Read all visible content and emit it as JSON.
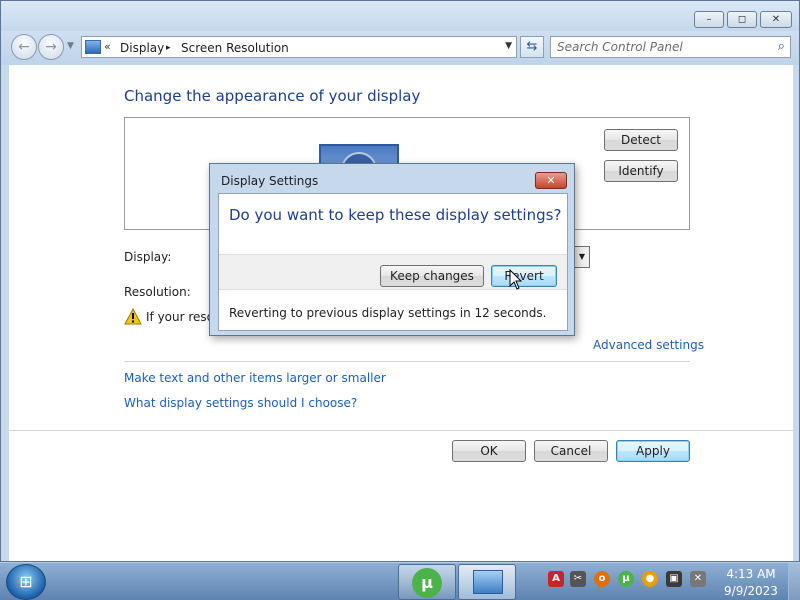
{
  "window": {
    "caption_buttons": {
      "minimize": "–",
      "maximize": "◻",
      "close": "✕"
    }
  },
  "navbar": {
    "back_icon": "arrow-left-icon",
    "forward_icon": "arrow-right-icon",
    "breadcrumb": [
      "Display",
      "Screen Resolution"
    ],
    "chevron": "«",
    "separator": "▸",
    "search_placeholder": "Search Control Panel"
  },
  "main": {
    "title": "Change the appearance of your display",
    "detect_label": "Detect",
    "identify_label": "Identify",
    "display_label": "Display:",
    "resolution_label": "Resolution:",
    "warning_text": "If your resolu",
    "advanced_link": "Advanced settings",
    "link_larger": "Make text and other items larger or smaller",
    "link_which": "What display settings should I choose?",
    "ok_label": "OK",
    "cancel_label": "Cancel",
    "apply_label": "Apply"
  },
  "dialog": {
    "title": "Display Settings",
    "question": "Do you want to keep these display settings?",
    "keep_label": "Keep changes",
    "revert_label": "Revert",
    "status": "Reverting to previous display settings in 12 seconds."
  },
  "taskbar": {
    "time": "4:13 AM",
    "date": "9/9/2023",
    "apps": [
      "utorrent",
      "control-panel"
    ]
  },
  "colors": {
    "accent_title": "#1e3f8a",
    "link": "#1e5fb3",
    "window_frame": "#c7d9ec"
  }
}
